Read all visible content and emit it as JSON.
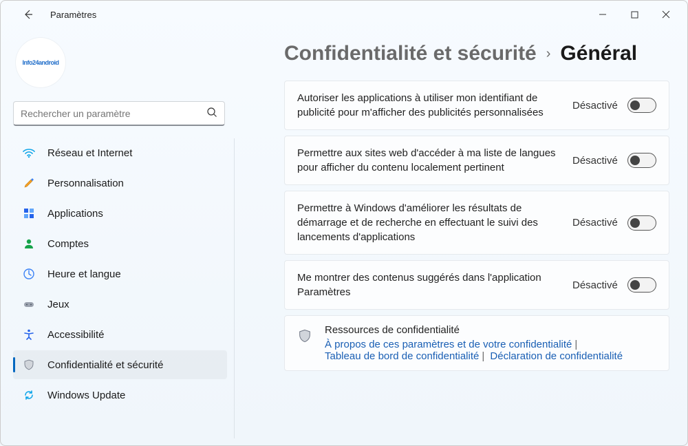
{
  "window": {
    "title": "Paramètres"
  },
  "search": {
    "placeholder": "Rechercher un paramètre"
  },
  "sidebar": {
    "items": [
      {
        "label": "Réseau et Internet"
      },
      {
        "label": "Personnalisation"
      },
      {
        "label": "Applications"
      },
      {
        "label": "Comptes"
      },
      {
        "label": "Heure et langue"
      },
      {
        "label": "Jeux"
      },
      {
        "label": "Accessibilité"
      },
      {
        "label": "Confidentialité et sécurité"
      },
      {
        "label": "Windows Update"
      }
    ]
  },
  "breadcrumb": {
    "parent": "Confidentialité et sécurité",
    "current": "Général"
  },
  "settings": [
    {
      "label": "Autoriser les applications à utiliser mon identifiant de publicité pour m'afficher des publicités personnalisées",
      "state": "Désactivé"
    },
    {
      "label": "Permettre aux sites web d'accéder à ma liste de langues pour afficher du contenu localement pertinent",
      "state": "Désactivé"
    },
    {
      "label": "Permettre à Windows d'améliorer les résultats de démarrage et de recherche en effectuant le suivi des lancements d'applications",
      "state": "Désactivé"
    },
    {
      "label": "Me montrer des contenus suggérés dans l'application Paramètres",
      "state": "Désactivé"
    }
  ],
  "resources": {
    "title": "Ressources de confidentialité",
    "link1": "À propos de ces paramètres et de votre confidentialité",
    "link2": "Tableau de bord de confidentialité",
    "link3": "Déclaration de confidentialité"
  }
}
